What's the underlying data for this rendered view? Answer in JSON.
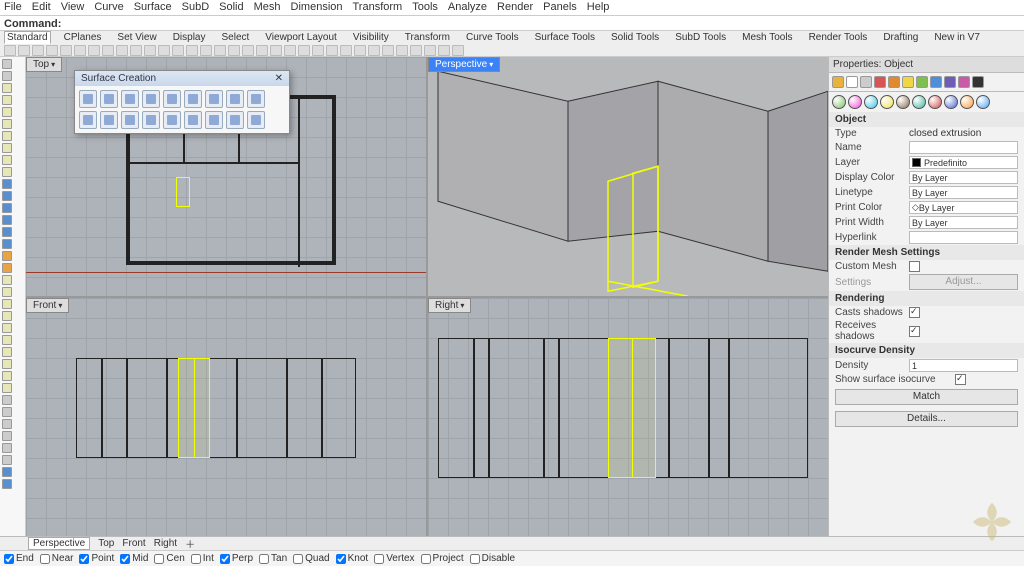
{
  "menu": [
    "File",
    "Edit",
    "View",
    "Curve",
    "Surface",
    "SubD",
    "Solid",
    "Mesh",
    "Dimension",
    "Transform",
    "Tools",
    "Analyze",
    "Render",
    "Panels",
    "Help"
  ],
  "command_label": "Command:",
  "toolbar_tabs": [
    "Standard",
    "CPlanes",
    "Set View",
    "Display",
    "Select",
    "Viewport Layout",
    "Visibility",
    "Transform",
    "Curve Tools",
    "Surface Tools",
    "Solid Tools",
    "SubD Tools",
    "Mesh Tools",
    "Render Tools",
    "Drafting",
    "New in V7"
  ],
  "viewports": {
    "top": "Top",
    "perspective": "Perspective",
    "front": "Front",
    "right": "Right"
  },
  "floating_panel_title": "Surface Creation",
  "floating_close": "✕",
  "props_title": "Properties: Object",
  "props_section_object": "Object",
  "props": {
    "type_label": "Type",
    "type_value": "closed extrusion",
    "name_label": "Name",
    "name_value": "",
    "layer_label": "Layer",
    "layer_value": "Predefinito",
    "display_color_label": "Display Color",
    "display_color_value": "By Layer",
    "linetype_label": "Linetype",
    "linetype_value": "By Layer",
    "print_color_label": "Print Color",
    "print_color_value": "By Layer",
    "print_width_label": "Print Width",
    "print_width_value": "By Layer",
    "hyperlink_label": "Hyperlink"
  },
  "render_mesh_header": "Render Mesh Settings",
  "render_mesh": {
    "custom_label": "Custom Mesh",
    "settings_label": "Settings",
    "adjust_btn": "Adjust..."
  },
  "rendering_header": "Rendering",
  "rendering": {
    "casts_label": "Casts shadows",
    "receives_label": "Receives shadows"
  },
  "iso_header": "Isocurve Density",
  "iso": {
    "density_label": "Density",
    "density_value": "1",
    "show_label": "Show surface isocurve"
  },
  "match_btn": "Match",
  "details_btn": "Details...",
  "bottom_tabs": [
    "Perspective",
    "Top",
    "Front",
    "Right",
    "＋"
  ],
  "osnaps": [
    {
      "label": "End",
      "checked": true
    },
    {
      "label": "Near",
      "checked": false
    },
    {
      "label": "Point",
      "checked": true
    },
    {
      "label": "Mid",
      "checked": true
    },
    {
      "label": "Cen",
      "checked": false
    },
    {
      "label": "Int",
      "checked": false
    },
    {
      "label": "Perp",
      "checked": true
    },
    {
      "label": "Tan",
      "checked": false
    },
    {
      "label": "Quad",
      "checked": false
    },
    {
      "label": "Knot",
      "checked": true
    },
    {
      "label": "Vertex",
      "checked": false
    },
    {
      "label": "Project",
      "checked": false
    },
    {
      "label": "Disable",
      "checked": false
    }
  ],
  "palette_colors": [
    "#e8b33a",
    "#ffffff",
    "#cccccc",
    "#d95454",
    "#e08a2e",
    "#f0d645",
    "#7fbf4f",
    "#4f8fd9",
    "#6f5bb8",
    "#c85aa8",
    "#333333"
  ],
  "material_colors": [
    "#7fc367",
    "#f74ed6",
    "#36c7e8",
    "#f0e24a",
    "#8a6e4e",
    "#44b6a0",
    "#d64a4a",
    "#4a68d6",
    "#ff9a3a",
    "#50a7f2"
  ]
}
